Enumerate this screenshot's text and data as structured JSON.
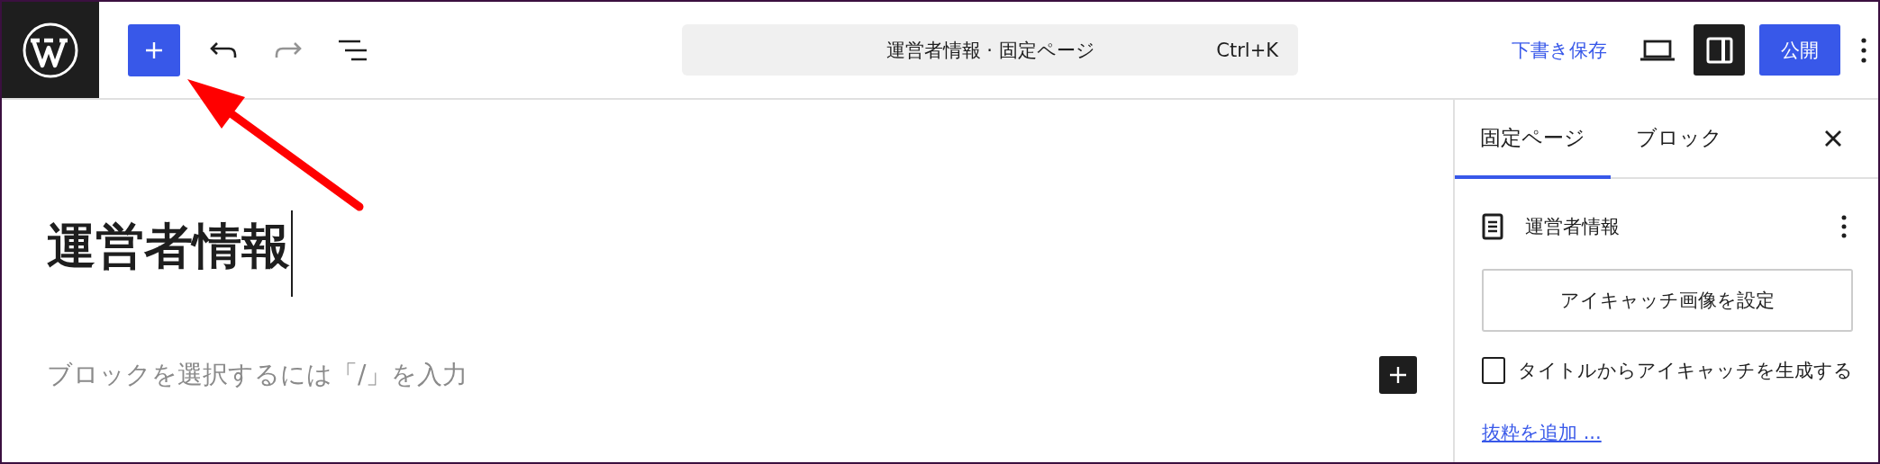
{
  "toolbar": {
    "command_bar": {
      "title": "運営者情報 · 固定ページ",
      "shortcut": "Ctrl+K"
    },
    "save_draft": "下書き保存",
    "settings_toggle": {
      "on": true
    },
    "publish": "公開"
  },
  "editor": {
    "title": "運営者情報",
    "placeholder": "ブロックを選択するには「/」を入力"
  },
  "sidebar": {
    "tabs": [
      {
        "label": "固定ページ",
        "selected": true
      },
      {
        "label": "ブロック",
        "selected": false
      }
    ],
    "page_title": "運営者情報",
    "featured_image_button": "アイキャッチ画像を設定",
    "generate_checkbox": {
      "label": "タイトルからアイキャッチを生成する",
      "checked": false
    },
    "excerpt_link": "抜粋を追加 ..."
  }
}
